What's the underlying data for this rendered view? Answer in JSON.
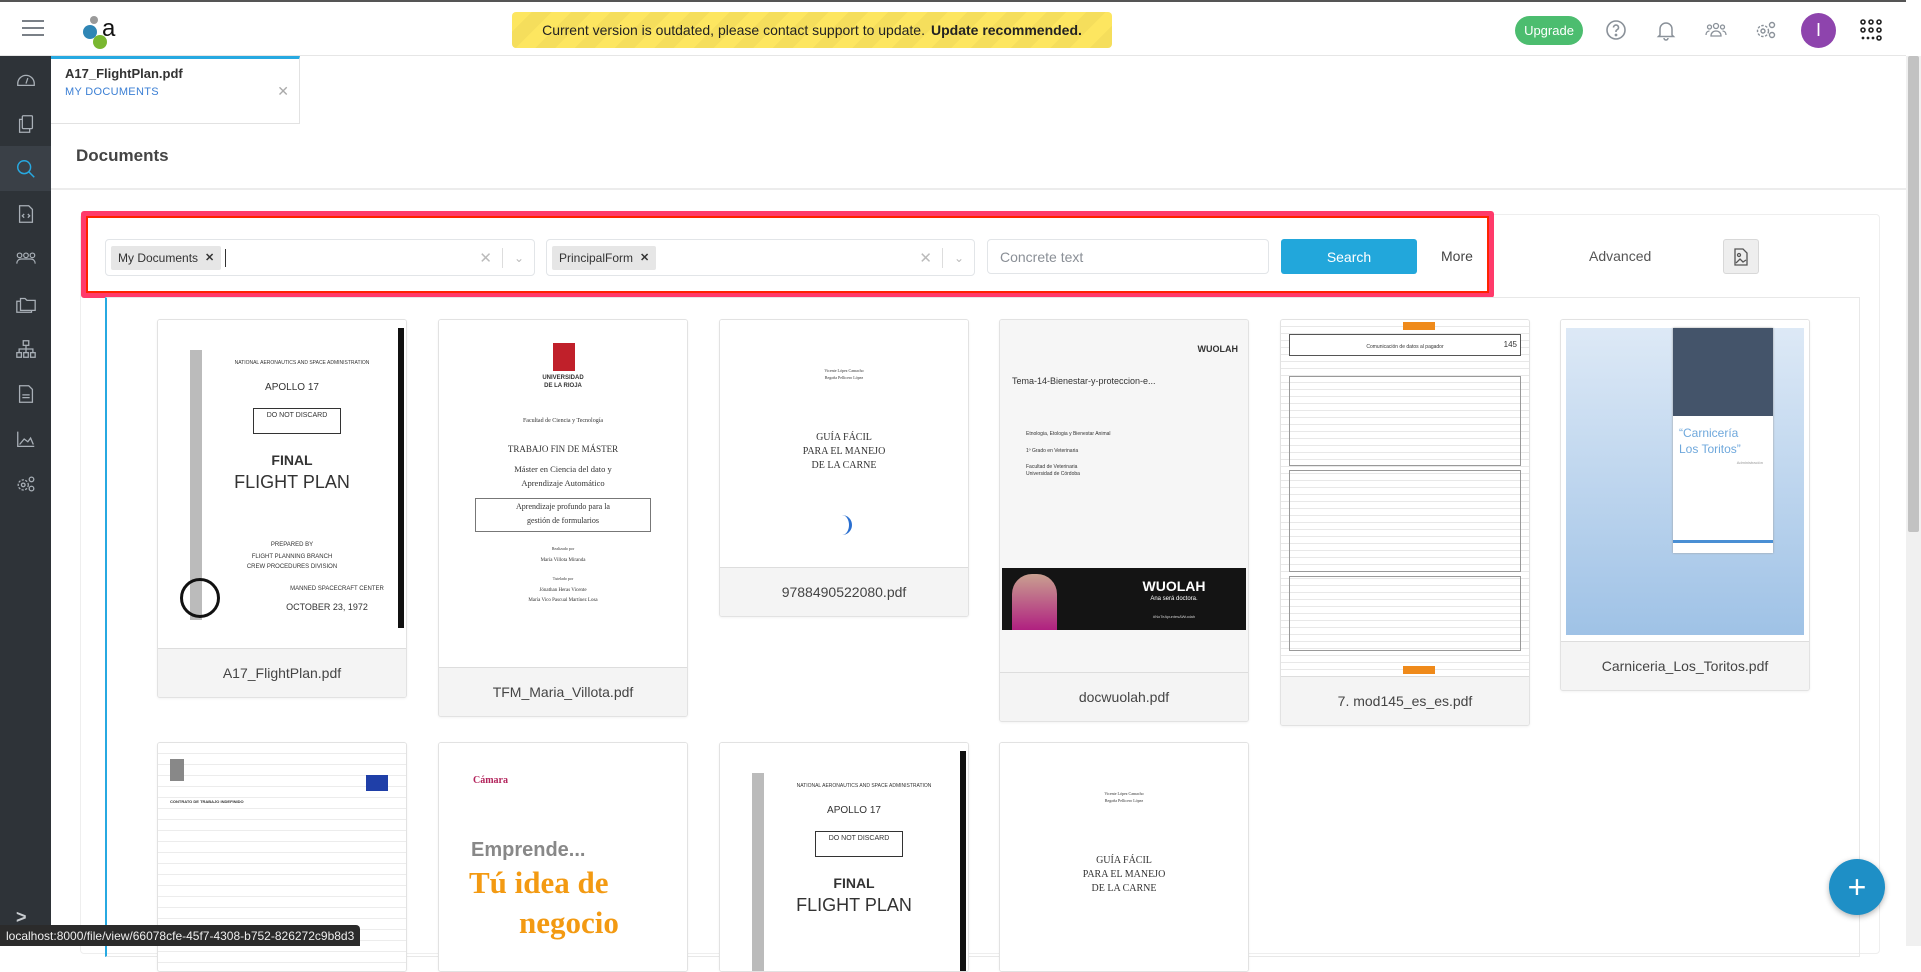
{
  "topbar": {
    "banner_text": "Current version is outdated, please contact support to update.",
    "banner_strong": "Update recommended.",
    "upgrade_label": "Upgrade",
    "avatar_initial": "I",
    "icons": [
      "menu-icon",
      "help-icon",
      "bell-icon",
      "users-icon",
      "settings-icon",
      "apps-grid-icon"
    ]
  },
  "sidebar": {
    "items": [
      {
        "icon": "dashboard-icon"
      },
      {
        "icon": "documents-icon"
      },
      {
        "icon": "search-icon",
        "active": true
      },
      {
        "icon": "code-file-icon"
      },
      {
        "icon": "users-icon"
      },
      {
        "icon": "folders-icon"
      },
      {
        "icon": "hierarchy-icon"
      },
      {
        "icon": "file-text-icon"
      },
      {
        "icon": "chart-icon"
      },
      {
        "icon": "settings-icon"
      }
    ],
    "expand_icon": "chevron-right-icon"
  },
  "tab": {
    "title": "A17_FlightPlan.pdf",
    "subtitle": "MY DOCUMENTS"
  },
  "page_title": "Documents",
  "search": {
    "source_chip": "My Documents",
    "form_chip": "PrincipalForm",
    "concrete_placeholder": "Concrete text",
    "concrete_value": "",
    "search_label": "Search",
    "more_label": "More",
    "advanced_label": "Advanced"
  },
  "colors": {
    "accent": "#22a7db",
    "upgrade": "#4cbd6f",
    "avatar": "#8e44ad",
    "highlight": "#ff3a6a",
    "banner": "#fde660"
  },
  "documents": [
    {
      "name": "A17_FlightPlan.pdf",
      "lines": [
        "NATIONAL AERONAUTICS AND SPACE ADMINISTRATION",
        "APOLLO 17",
        "DO NOT DISCARD",
        "FINAL",
        "FLIGHT PLAN",
        "PREPARED BY",
        "FLIGHT PLANNING BRANCH",
        "CREW PROCEDURES DIVISION",
        "MANNED SPACECRAFT CENTER",
        "OCTOBER 23, 1972"
      ]
    },
    {
      "name": "TFM_Maria_Villota.pdf",
      "lines": [
        "UNIVERSIDAD",
        "DE LA RIOJA",
        "Facultad de Ciencia y Tecnología",
        "TRABAJO FIN DE MÁSTER",
        "Máster en Ciencia del dato y",
        "Aprendizaje Automático",
        "Aprendizaje profundo para la",
        "gestión de formularios",
        "Realizado por",
        "María Villota Miranda",
        "Tutelado por",
        "Jónathan Heras Vicente",
        "María Vico Pascual Martínez Losa"
      ]
    },
    {
      "name": "9788490522080.pdf",
      "lines": [
        "Vicente López Camacho",
        "Begoña Pellicero López",
        "GUÍA FÁCIL",
        "PARA EL MANEJO",
        "DE LA CARNE"
      ]
    },
    {
      "name": "docwuolah.pdf",
      "lines": [
        "WUOLAH",
        "Tema-14-Bienestar-y-proteccion-e...",
        "Etnologia, Etologia y Bienestar Animal",
        "1º Grado en Veterinaria",
        "Facultad de Veterinaria",
        "Universidad de Córdoba",
        "WUOLAH",
        "Ana será doctora.",
        "#NoTeApuntesAWuolah"
      ]
    },
    {
      "name": "7. mod145_es_es.pdf",
      "lines": [
        "Comunicación de datos al pagador",
        "145"
      ]
    },
    {
      "name": "Carniceria_Los_Toritos.pdf",
      "lines": [
        "“Carnicería",
        "Los Toritos”",
        "Administración"
      ]
    },
    {
      "name": "",
      "lines": [
        "CONTRATO DE TRABAJO INDEFINIDO"
      ]
    },
    {
      "name": "",
      "lines": [
        "Cámara",
        "Emprende...",
        "Tú idea de",
        "negocio"
      ]
    },
    {
      "name": "",
      "lines": [
        "NATIONAL AERONAUTICS AND SPACE ADMINISTRATION",
        "APOLLO 17",
        "DO NOT DISCARD",
        "FINAL",
        "FLIGHT PLAN"
      ]
    },
    {
      "name": "",
      "lines": [
        "Vicente López Camacho",
        "Begoña Pellicero López",
        "GUÍA FÁCIL",
        "PARA EL MANEJO",
        "DE LA CARNE"
      ]
    }
  ],
  "fab_icon": "plus-icon",
  "status_url": "localhost:8000/file/view/66078cfe-45f7-4308-b752-826272c9b8d3"
}
